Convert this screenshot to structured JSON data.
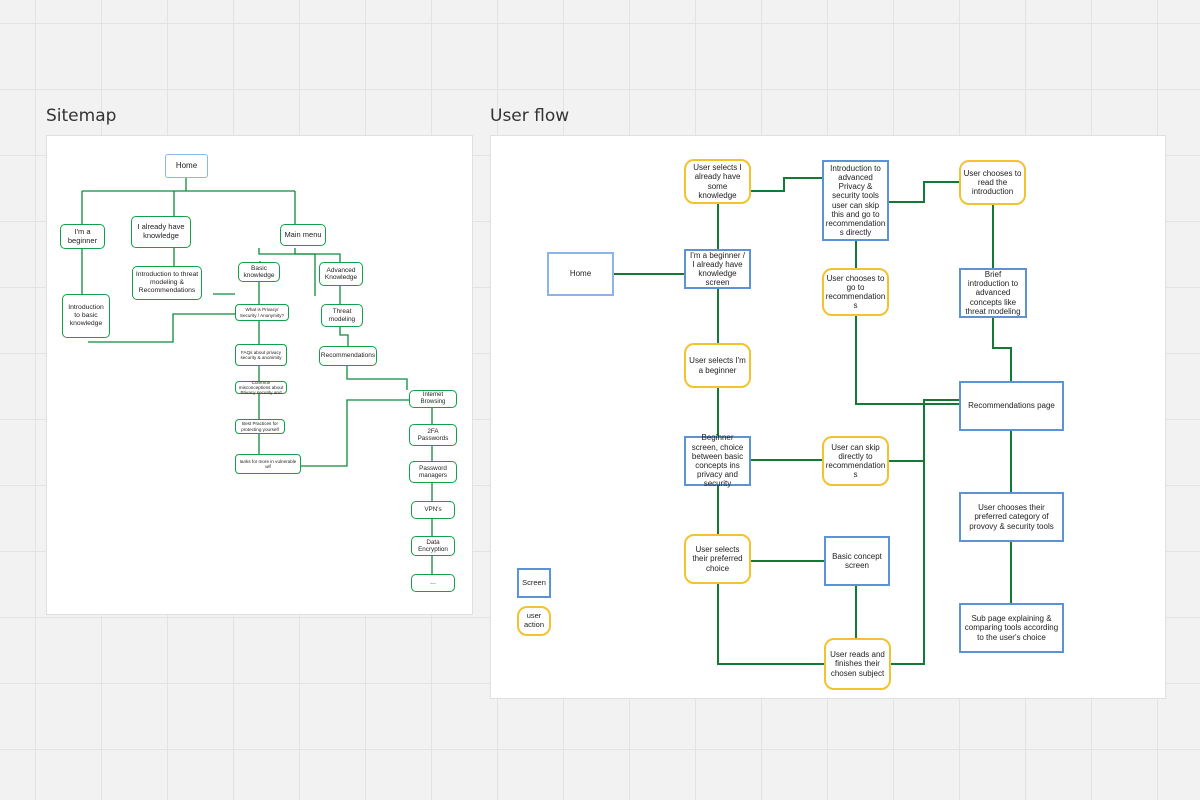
{
  "sitemap": {
    "title": "Sitemap",
    "nodes": {
      "home": "Home",
      "beginner": "I'm a beginner",
      "knowledge": "I already have knowledge",
      "main_menu": "Main menu",
      "intro_threat": "Introduction to threat modeling & Recommendations",
      "basic_knowledge": "Basic knowledge",
      "advanced_knowledge": "Advanced Knowledge",
      "intro_basic": "Introduction to basic knowledge",
      "what_is": "What is Privacy/ Security / Anonymity?",
      "threat_modeling": "Threat modeling",
      "faqs": "FAQs about privacy security & anonimity",
      "recommendations": "Recommendations",
      "misconceptions": "Common misconceptions about Privacy security and",
      "internet_browsing": "Internet Browsing",
      "best_practices": "Best Practices for protecting yourself",
      "twofa": "2FA Passwords",
      "vulnerable": "Ianks for more in vulnerable wif",
      "password_managers": "Password managers",
      "vpns": "VPN's",
      "data_encryption": "Data Encryption",
      "more": "..."
    }
  },
  "userflow": {
    "title": "User flow",
    "nodes": {
      "home": "Home",
      "selects_knowledge": "User selects I already have some knowledge",
      "beginner_screen_choice": "I'm a beginner / I already have knowledge screen",
      "selects_beginner": "User selects I'm a beginner",
      "beginner_screen": "Beginner screen, choice between basic concepts ins privacy and security",
      "selects_preferred": "User selects their preferred choice",
      "intro_advanced": "Introduction to advanced Privacy & security tools user can skip this and go to recommendation s directly",
      "go_to_reco": "User chooses to go to recommendation s",
      "skip_reco": "User can skip directly to recommendation s",
      "basic_concept": "Basic concept screen",
      "reads_finishes": "User reads and finishes their chosen subject",
      "chooses_read": "User chooses to read the introduction",
      "brief_intro": "Brief introduction to advanced concepts like threat modeling",
      "reco_page": "Recommendations page",
      "choose_category": "User chooses their preferred category of provovy & security tools",
      "sub_page": "Sub page explaining & comparing tools according to the user's choice"
    },
    "legend": {
      "screen": "Screen",
      "action": "user action"
    }
  },
  "colors": {
    "sitemap_green": "#14a048",
    "sitemap_blue": "#8bb8ec",
    "flow_screen_blue": "#5b93d6",
    "flow_action_yellow": "#f2c230",
    "connector_green": "#127a35"
  }
}
